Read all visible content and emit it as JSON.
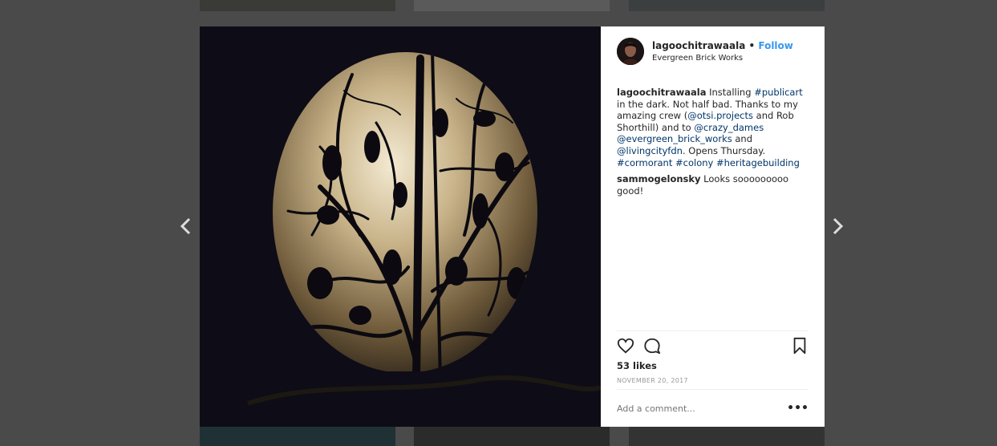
{
  "post": {
    "username": "lagoochitrawaala",
    "separator": "•",
    "follow_label": "Follow",
    "location": "Evergreen Brick Works",
    "caption": [
      {
        "type": "user",
        "text": "lagoochitrawaala"
      },
      {
        "type": "text",
        "text": " Installing "
      },
      {
        "type": "link",
        "text": "#publicart"
      },
      {
        "type": "text",
        "text": " in the dark. Not half bad. Thanks to my amazing crew ("
      },
      {
        "type": "link",
        "text": "@otsi.projects"
      },
      {
        "type": "text",
        "text": " and Rob Shorthill) and to "
      },
      {
        "type": "link",
        "text": "@crazy_dames"
      },
      {
        "type": "text",
        "text": " "
      },
      {
        "type": "link",
        "text": "@evergreen_brick_works"
      },
      {
        "type": "text",
        "text": " and "
      },
      {
        "type": "link",
        "text": "@livingcityfdn"
      },
      {
        "type": "text",
        "text": ". Opens Thursday. "
      },
      {
        "type": "link",
        "text": "#cormorant"
      },
      {
        "type": "text",
        "text": " "
      },
      {
        "type": "link",
        "text": "#colony"
      },
      {
        "type": "text",
        "text": " "
      },
      {
        "type": "link",
        "text": "#heritagebuilding"
      }
    ],
    "comment": {
      "user": "sammogelonsky",
      "text": " Looks sooooooooo good!"
    },
    "likes": "53 likes",
    "date": "NOVEMBER 20, 2017",
    "add_comment_placeholder": "Add a comment...",
    "more_label": "•••"
  },
  "icons": {
    "prev": "chevron-left-icon",
    "next": "chevron-right-icon",
    "like": "heart-icon",
    "comment": "comment-icon",
    "save": "bookmark-icon"
  },
  "colors": {
    "follow": "#3897f0",
    "link": "#003569",
    "overlay": "#4a4a4a"
  }
}
